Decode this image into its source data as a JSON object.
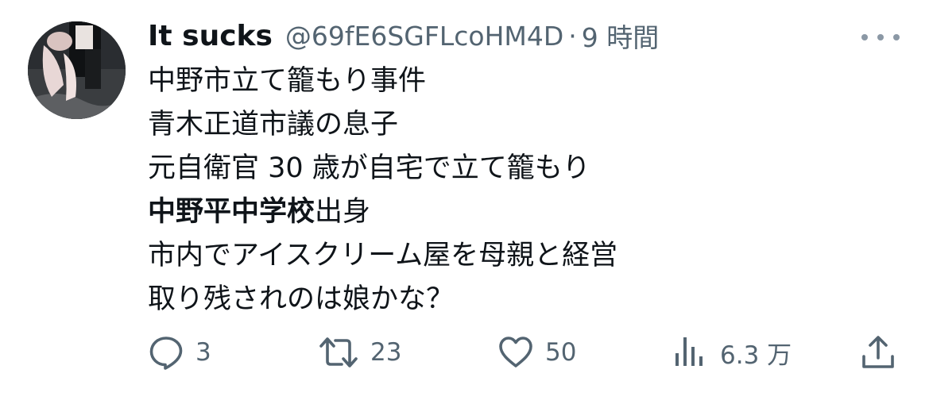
{
  "tweet": {
    "display_name": "It sucks",
    "handle": "@69fE6SGFLcoHM4D",
    "separator": "·",
    "time": "9 時間",
    "lines": [
      {
        "text": "中野市立て籠もり事件"
      },
      {
        "text": "青木正道市議の息子"
      },
      {
        "text": "元自衛官 30 歳が自宅で立て籠もり"
      },
      {
        "bold": "中野平中学校",
        "text": "出身"
      },
      {
        "text": "市内でアイスクリーム屋を母親と経営"
      },
      {
        "text": "取り残されのは娘かな？"
      }
    ]
  },
  "actions": {
    "reply": {
      "icon": "reply-icon",
      "count": "3"
    },
    "retweet": {
      "icon": "retweet-icon",
      "count": "23"
    },
    "like": {
      "icon": "heart-icon",
      "count": "50"
    },
    "views": {
      "icon": "views-icon",
      "count": "6.3 万"
    },
    "share": {
      "icon": "share-icon"
    }
  },
  "colors": {
    "text": "#0f1419",
    "secondary": "#536471",
    "icon": "#536471"
  }
}
